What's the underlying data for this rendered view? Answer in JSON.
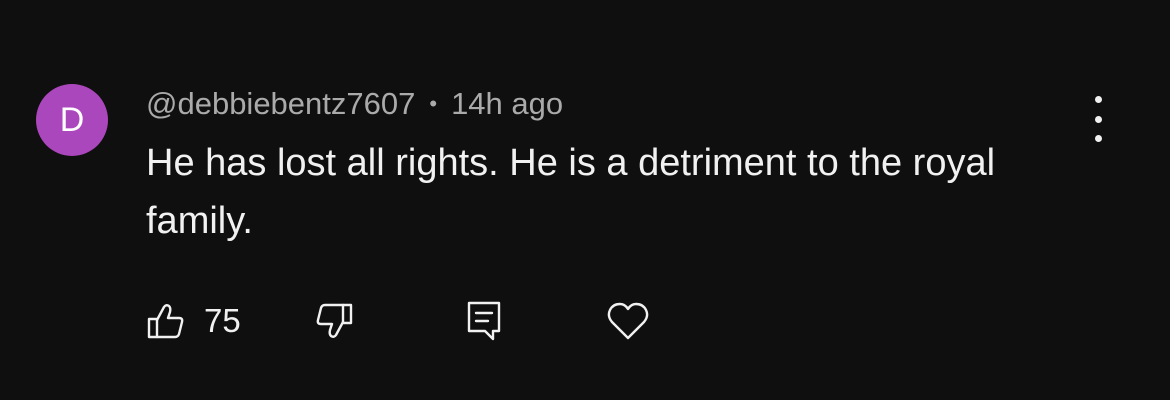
{
  "comment": {
    "avatar_initial": "D",
    "avatar_color": "#ab47bc",
    "author": "@debbiebentz7607",
    "separator": "•",
    "timestamp": "14h ago",
    "text": "He has lost all rights. He is a detriment to the royal family.",
    "like_count": "75"
  },
  "icons": {
    "menu": "more-vertical-icon",
    "like": "thumbs-up-icon",
    "dislike": "thumbs-down-icon",
    "reply": "reply-comment-icon",
    "heart": "heart-icon"
  },
  "colors": {
    "background": "#0f0f0f",
    "text": "#f1f1f1",
    "secondary_text": "#aaaaaa"
  }
}
